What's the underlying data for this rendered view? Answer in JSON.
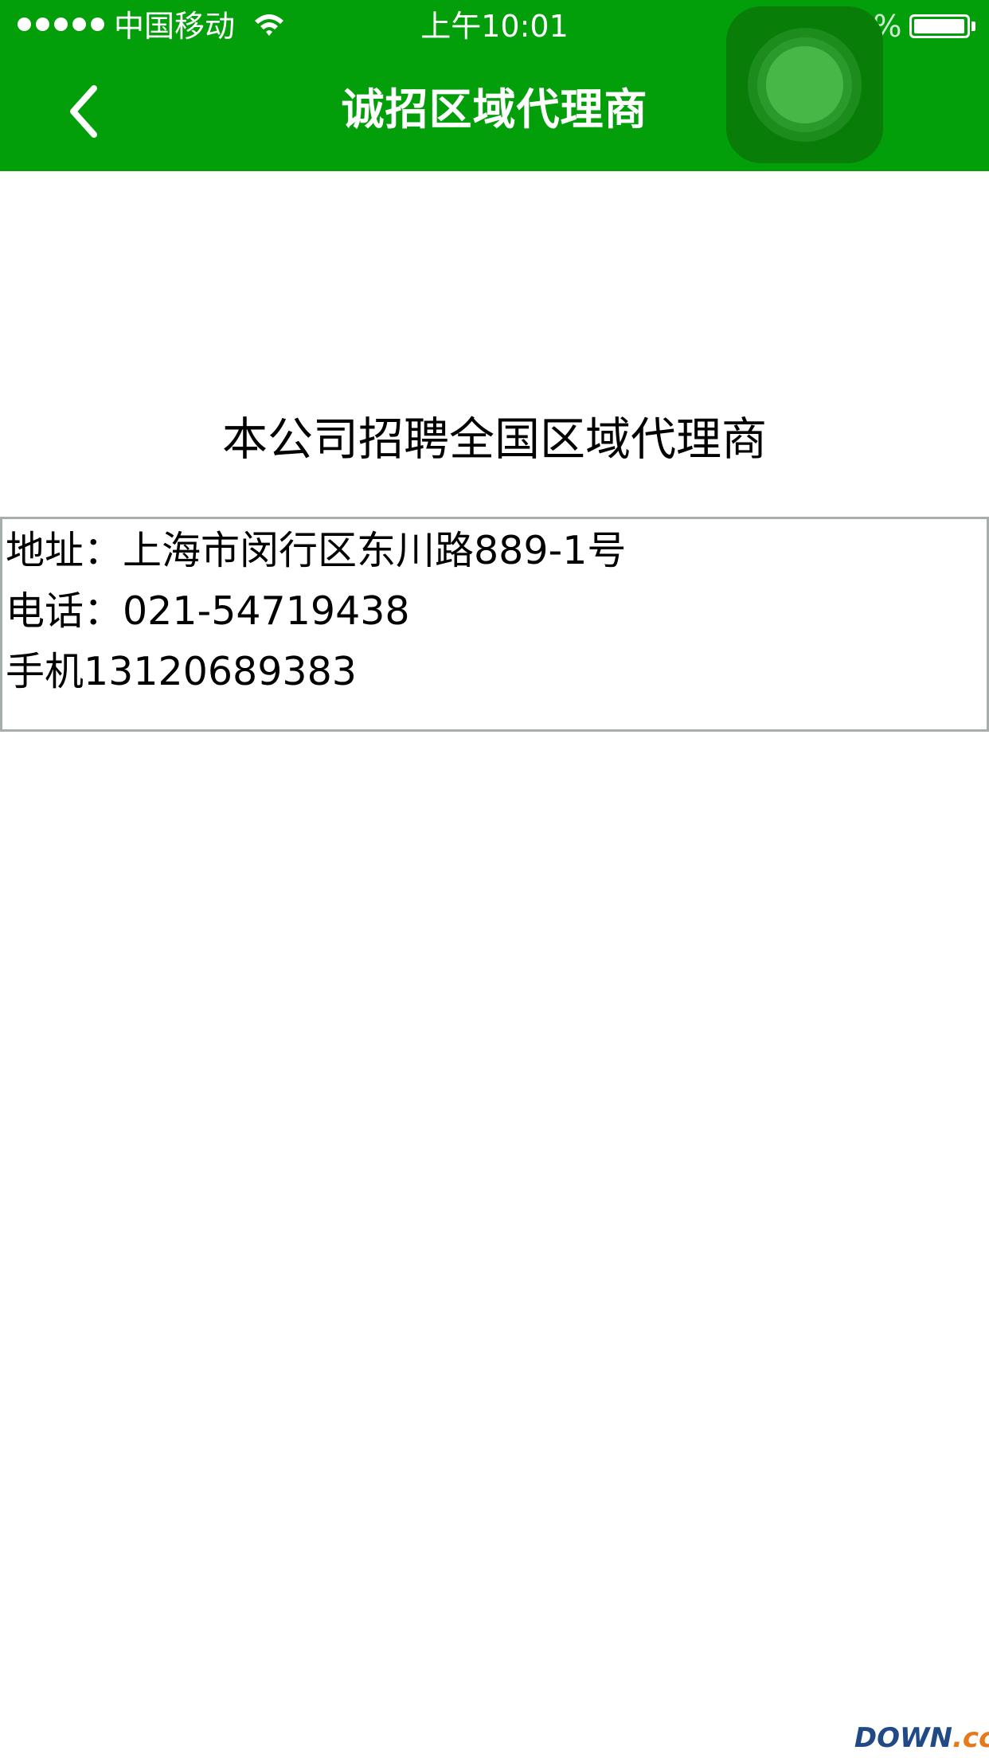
{
  "status_bar": {
    "carrier": "中国移动",
    "time": "上午10:01",
    "battery_percent": "99%",
    "battery_level": 0.99,
    "signal_bars": 5
  },
  "nav": {
    "title": "诚招区域代理商",
    "back_icon": "chevron-left-icon"
  },
  "content": {
    "headline": "本公司招聘全国区域代理商",
    "address": "地址：上海市闵行区东川路889-1号",
    "phone": "电话：021-54719438",
    "mobile": "手机13120689383"
  },
  "watermark": {
    "part1": "DOWN",
    "part2": ".cc"
  },
  "colors": {
    "header_bg": "#039f0b",
    "box_border": "#a6aeaa",
    "assistive_touch": "#087e09"
  }
}
